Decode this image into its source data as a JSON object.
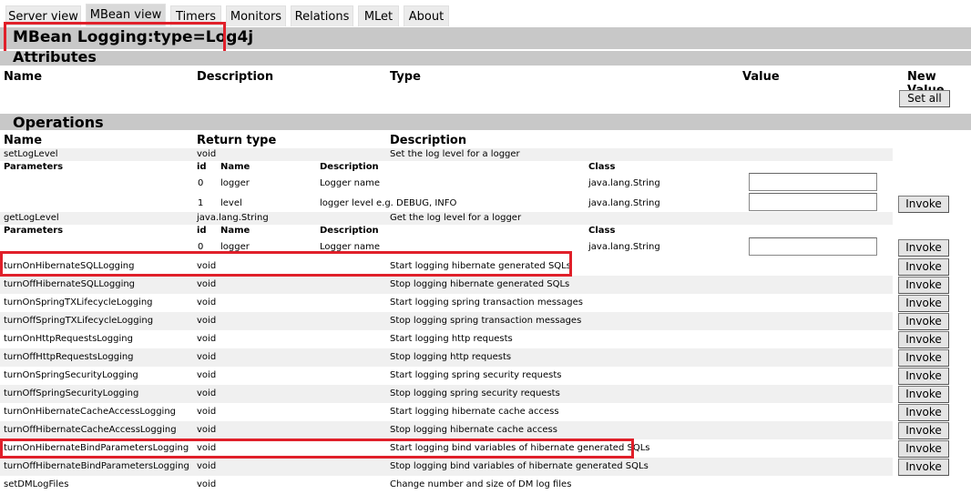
{
  "tabs": [
    "Server view",
    "MBean view",
    "Timers",
    "Monitors",
    "Relations",
    "MLet",
    "About"
  ],
  "title": "MBean Logging:type=Log4j",
  "attributes": {
    "heading": "Attributes",
    "headers": {
      "name": "Name",
      "description": "Description",
      "type": "Type",
      "value": "Value",
      "new_value": "New Value"
    },
    "set_all_label": "Set all"
  },
  "operations": {
    "heading": "Operations",
    "headers": {
      "name": "Name",
      "return_type": "Return type",
      "description": "Description"
    },
    "param_headers": {
      "parameters": "Parameters",
      "id": "id",
      "name": "Name",
      "description": "Description",
      "class": "Class"
    },
    "invoke_label": "Invoke",
    "op1": {
      "name": "setLogLevel",
      "ret": "void",
      "desc": "Set the log level for a logger",
      "params": [
        {
          "id": "0",
          "name": "logger",
          "desc": "Logger name",
          "cls": "java.lang.String"
        },
        {
          "id": "1",
          "name": "level",
          "desc": "logger level e.g. DEBUG, INFO",
          "cls": "java.lang.String"
        }
      ]
    },
    "op2": {
      "name": "getLogLevel",
      "ret": "java.lang.String",
      "desc": "Get the log level for a logger",
      "params": [
        {
          "id": "0",
          "name": "logger",
          "desc": "Logger name",
          "cls": "java.lang.String"
        }
      ]
    },
    "rows": [
      {
        "name": "turnOnHibernateSQLLogging",
        "ret": "void",
        "desc": "Start logging hibernate generated SQLs"
      },
      {
        "name": "turnOffHibernateSQLLogging",
        "ret": "void",
        "desc": "Stop logging hibernate generated SQLs"
      },
      {
        "name": "turnOnSpringTXLifecycleLogging",
        "ret": "void",
        "desc": "Start logging spring transaction messages"
      },
      {
        "name": "turnOffSpringTXLifecycleLogging",
        "ret": "void",
        "desc": "Stop logging spring transaction messages"
      },
      {
        "name": "turnOnHttpRequestsLogging",
        "ret": "void",
        "desc": "Start logging http requests"
      },
      {
        "name": "turnOffHttpRequestsLogging",
        "ret": "void",
        "desc": "Stop logging http requests"
      },
      {
        "name": "turnOnSpringSecurityLogging",
        "ret": "void",
        "desc": "Start logging spring security requests"
      },
      {
        "name": "turnOffSpringSecurityLogging",
        "ret": "void",
        "desc": "Stop logging spring security requests"
      },
      {
        "name": "turnOnHibernateCacheAccessLogging",
        "ret": "void",
        "desc": "Start logging hibernate cache access"
      },
      {
        "name": "turnOffHibernateCacheAccessLogging",
        "ret": "void",
        "desc": "Stop logging hibernate cache access"
      },
      {
        "name": "turnOnHibernateBindParametersLogging",
        "ret": "void",
        "desc": "Start logging bind variables of hibernate generated SQLs"
      },
      {
        "name": "turnOffHibernateBindParametersLogging",
        "ret": "void",
        "desc": "Stop logging bind variables of hibernate generated SQLs"
      },
      {
        "name": "setDMLogFiles",
        "ret": "void",
        "desc": "Change number and size of DM log files"
      }
    ]
  }
}
